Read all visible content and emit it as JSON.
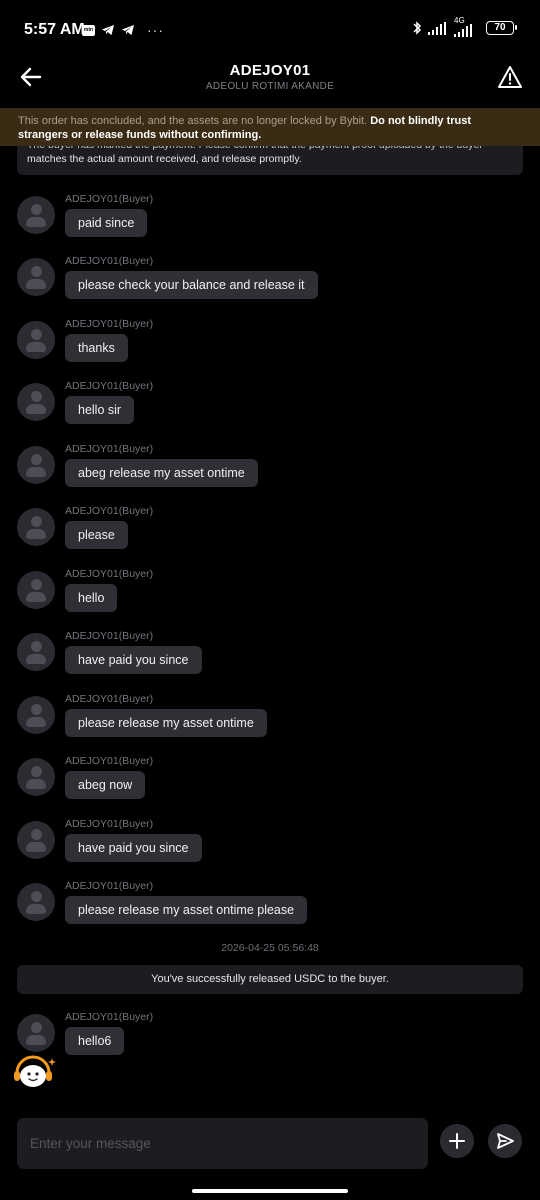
{
  "status": {
    "time": "5:57 AM",
    "dots": "···",
    "network": "4G",
    "battery": "70"
  },
  "header": {
    "title": "ADEJOY01",
    "subtitle": "ADEOLU ROTIMI AKANDE"
  },
  "notice": {
    "text": "This order has concluded, and the assets are no longer locked by Bybit. ",
    "bold": "Do not blindly trust strangers or release funds without confirming."
  },
  "system_top": {
    "line1": "The buyer has marked the payment. Please confirm that the payment proof uploaded by the buyer",
    "line2": "matches the actual amount received, and release promptly."
  },
  "sender_label": "ADEJOY01(Buyer)",
  "messages": [
    {
      "sender": "ADEJOY01(Buyer)",
      "text": "paid since"
    },
    {
      "sender": "ADEJOY01(Buyer)",
      "text": "please check your balance and release it"
    },
    {
      "sender": "ADEJOY01(Buyer)",
      "text": "thanks"
    },
    {
      "sender": "ADEJOY01(Buyer)",
      "text": "hello sir"
    },
    {
      "sender": "ADEJOY01(Buyer)",
      "text": "abeg release my asset ontime"
    },
    {
      "sender": "ADEJOY01(Buyer)",
      "text": "please"
    },
    {
      "sender": "ADEJOY01(Buyer)",
      "text": "hello"
    },
    {
      "sender": "ADEJOY01(Buyer)",
      "text": "have paid you since"
    },
    {
      "sender": "ADEJOY01(Buyer)",
      "text": "please release my asset ontime"
    },
    {
      "sender": "ADEJOY01(Buyer)",
      "text": "abeg now"
    },
    {
      "sender": "ADEJOY01(Buyer)",
      "text": "have paid you since"
    },
    {
      "sender": "ADEJOY01(Buyer)",
      "text": "please release my asset ontime please"
    }
  ],
  "timestamp": "2026-04-25 05:56:48",
  "system_released": "You've successfully released USDC to the buyer.",
  "last_message": {
    "sender": "ADEJOY01(Buyer)",
    "text": "hello6"
  },
  "composer": {
    "placeholder": "Enter your message"
  },
  "colors": {
    "background": "#000000",
    "bubble": "#2e3036",
    "notice_bg": "#3a2c14",
    "system_bg": "#1c1d21"
  }
}
